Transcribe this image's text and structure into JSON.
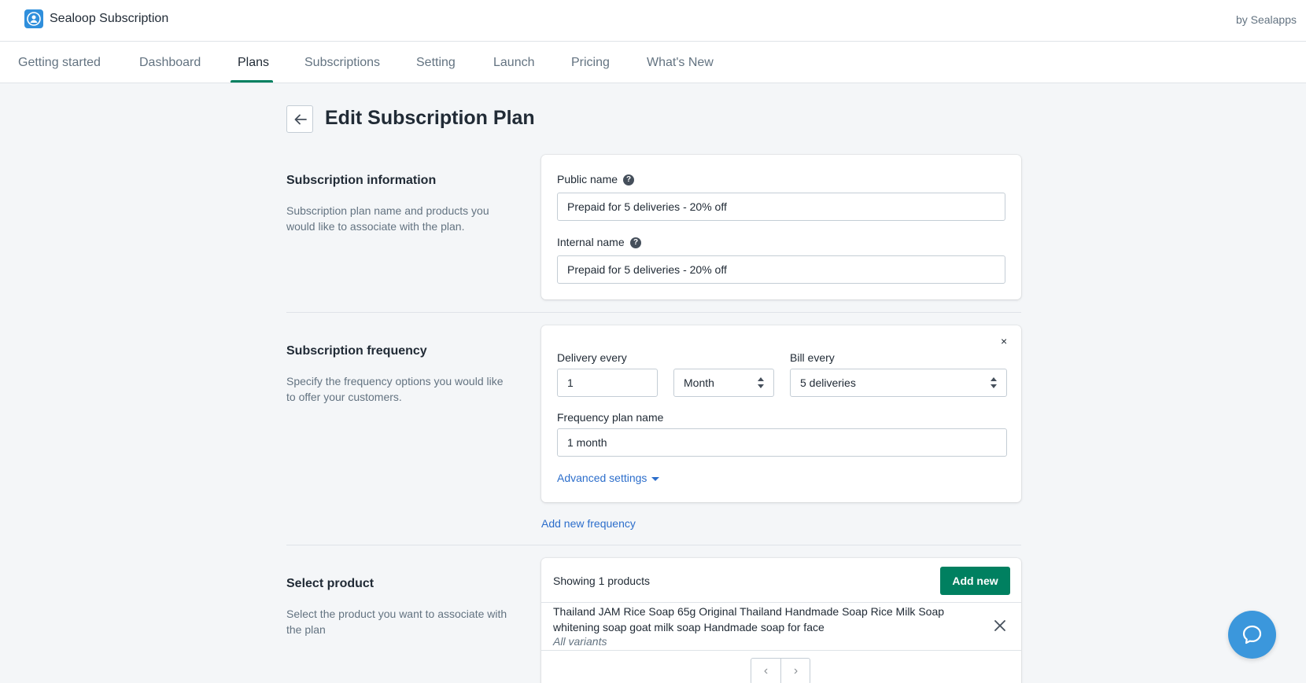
{
  "app": {
    "name": "Sealoop Subscription",
    "byline": "by Sealapps"
  },
  "nav": {
    "items": [
      {
        "label": "Getting started"
      },
      {
        "label": "Dashboard"
      },
      {
        "label": "Plans"
      },
      {
        "label": "Subscriptions"
      },
      {
        "label": "Setting"
      },
      {
        "label": "Launch"
      },
      {
        "label": "Pricing"
      },
      {
        "label": "What's New"
      }
    ],
    "active": "Plans"
  },
  "page": {
    "title": "Edit Subscription Plan"
  },
  "info_section": {
    "title": "Subscription information",
    "description": "Subscription plan name and products you would like to associate with the plan.",
    "public_name_label": "Public name",
    "public_name_value": "Prepaid for 5 deliveries - 20% off",
    "internal_name_label": "Internal name",
    "internal_name_value": "Prepaid for 5 deliveries - 20% off"
  },
  "frequency_section": {
    "title": "Subscription frequency",
    "description": "Specify the frequency options you would like to offer your customers.",
    "delivery_label": "Delivery every",
    "delivery_value": "1",
    "delivery_unit": "Month",
    "bill_label": "Bill every",
    "bill_value": "5 deliveries",
    "plan_name_label": "Frequency plan name",
    "plan_name_value": "1 month",
    "advanced_link": "Advanced settings",
    "add_frequency_link": "Add new frequency",
    "remove_symbol": "×"
  },
  "product_section": {
    "title": "Select product",
    "description": "Select the product you want to associate with the plan",
    "showing_text": "Showing 1 products",
    "add_button": "Add new",
    "products": [
      {
        "title": "Thailand JAM Rice Soap 65g Original Thailand Handmade Soap Rice Milk Soap whitening soap goat milk soap Handmade soap for face",
        "variants": "All variants"
      }
    ],
    "pager_prev": "‹",
    "pager_next": "›"
  },
  "help_symbol": "?",
  "colors": {
    "primary": "#008060",
    "link": "#2c6ecb",
    "chat": "#3b97dc",
    "logo": "#2f8fdc",
    "background": "#f4f6f8"
  },
  "icons": {
    "logo": "app-logo-icon",
    "back": "arrow-left-icon",
    "help": "question-circle-icon",
    "remove": "close-icon",
    "chat": "chat-bubble-icon"
  }
}
